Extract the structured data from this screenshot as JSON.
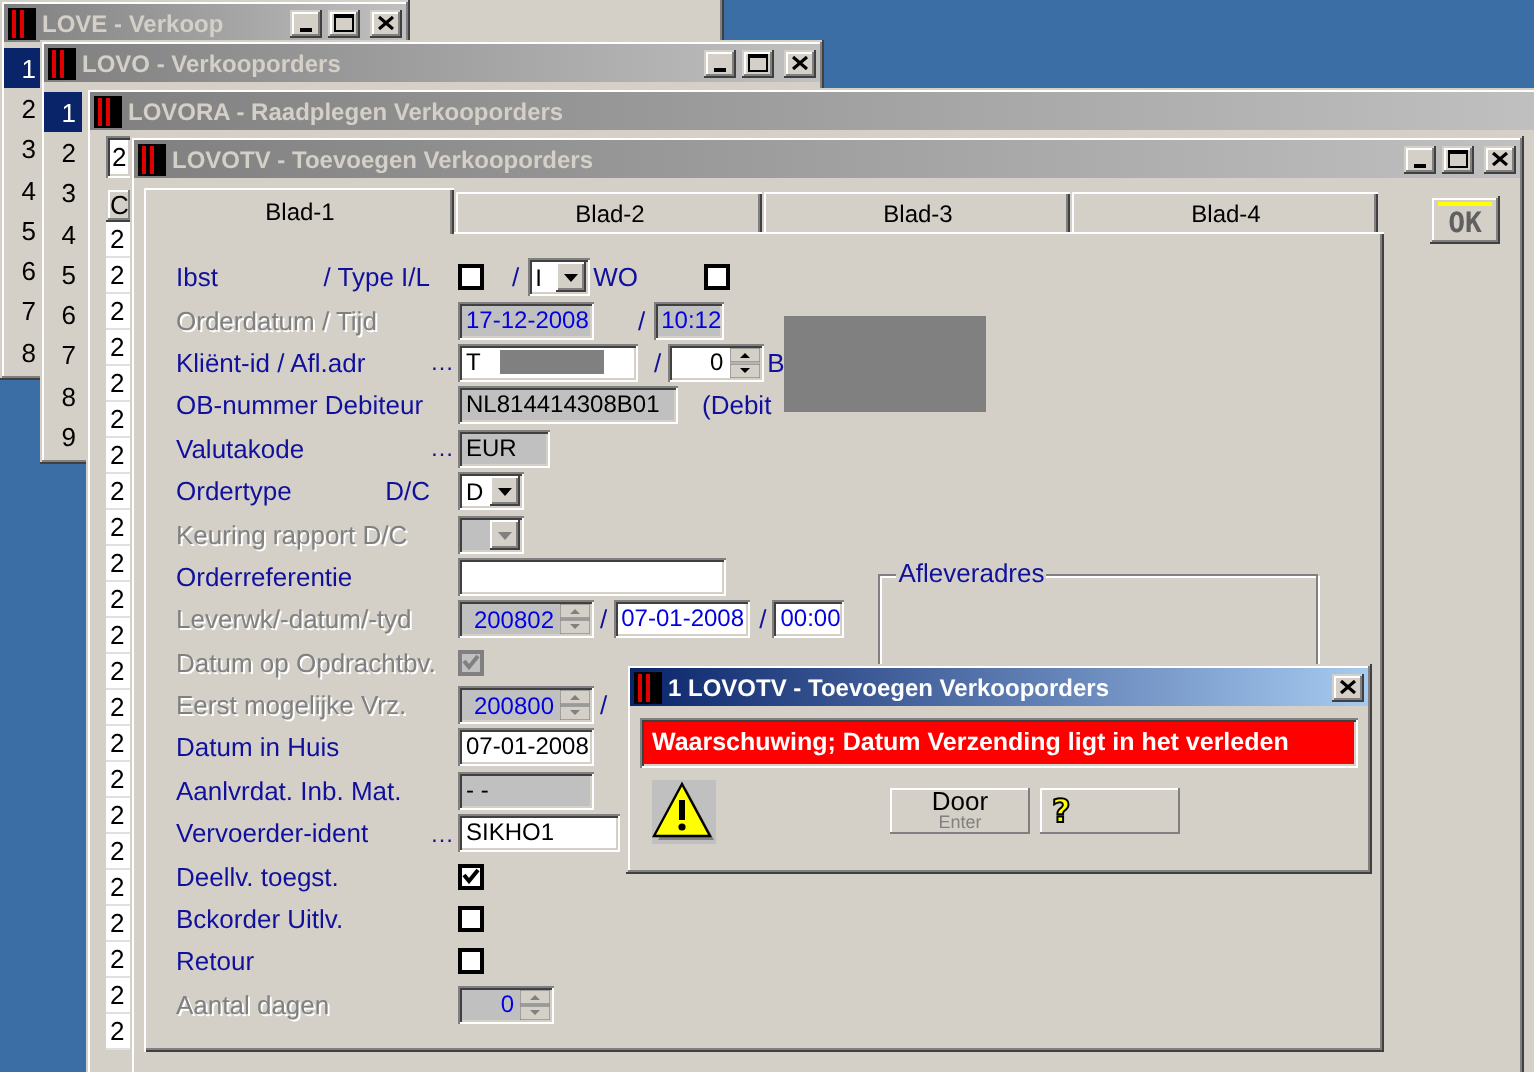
{
  "windows": [
    {
      "kind": "list",
      "title": "LOVE - Verkoop",
      "window_buttons": true,
      "items": [
        {
          "label": "1",
          "selected": true
        },
        {
          "label": "2",
          "selected": false
        },
        {
          "label": "3",
          "selected": false
        },
        {
          "label": "4",
          "selected": false
        },
        {
          "label": "5",
          "selected": false
        },
        {
          "label": "6",
          "selected": false
        },
        {
          "label": "7",
          "selected": false
        },
        {
          "label": "8",
          "selected": false
        }
      ]
    },
    {
      "kind": "list",
      "title": "LOVO - Verkooporders",
      "window_buttons": true,
      "items": [
        {
          "label": "1",
          "selected": true
        },
        {
          "label": "2",
          "selected": false
        },
        {
          "label": "3",
          "selected": false
        },
        {
          "label": "4",
          "selected": false
        },
        {
          "label": "5",
          "selected": false
        },
        {
          "label": "6",
          "selected": false
        },
        {
          "label": "7",
          "selected": false
        },
        {
          "label": "8",
          "selected": false
        },
        {
          "label": "9",
          "selected": false
        }
      ]
    },
    {
      "kind": "table",
      "title": "LOVORA - Raadplegen Verkooporders",
      "window_buttons": false,
      "field_value": "2",
      "column": "C",
      "rows": [
        "2",
        "2",
        "2",
        "2",
        "2",
        "2",
        "2",
        "2",
        "2",
        "2",
        "2",
        "2",
        "2",
        "2",
        "2",
        "2",
        "2",
        "2",
        "2",
        "2",
        "2",
        "2",
        "2"
      ]
    }
  ],
  "main_window": {
    "title": "LOVOTV - Toevoegen Verkooporders",
    "window_buttons": true,
    "tabs": [
      {
        "label": "Blad-1",
        "selected": true
      },
      {
        "label": "Blad-2",
        "selected": false
      },
      {
        "label": "Blad-3",
        "selected": false
      },
      {
        "label": "Blad-4",
        "selected": false
      }
    ],
    "ok_button": "OK",
    "form": [
      {
        "label": "Ibst",
        "label2": "/ Type I/L",
        "disabled": false,
        "controls": [
          {
            "kind": "checkbox",
            "checked": false
          },
          {
            "kind": "text",
            "text": "/"
          },
          {
            "kind": "combo",
            "value": "I"
          },
          {
            "kind": "text",
            "text": "WO"
          },
          {
            "kind": "checkbox",
            "checked": false
          }
        ]
      },
      {
        "label": "Orderdatum / Tijd",
        "disabled": true,
        "controls": [
          {
            "kind": "field",
            "value": "17-12-2008",
            "readonly": true
          },
          {
            "kind": "text",
            "text": "/"
          },
          {
            "kind": "field",
            "value": "10:12",
            "readonly": true
          }
        ]
      },
      {
        "label": "Kliënt-id / Afl.adr",
        "lookup": "…",
        "disabled": false,
        "controls": [
          {
            "kind": "field",
            "value": "T",
            "readonly": false,
            "redacted": true
          },
          {
            "kind": "text",
            "text": "/"
          },
          {
            "kind": "spin",
            "value": "0",
            "readonly": false
          },
          {
            "kind": "text",
            "text": "B"
          },
          {
            "kind": "redacted"
          }
        ]
      },
      {
        "label": "OB-nummer Debiteur",
        "disabled": false,
        "controls": [
          {
            "kind": "field",
            "value": "NL814414308B01",
            "readonly": true
          },
          {
            "kind": "text",
            "text": "(Debit"
          }
        ]
      },
      {
        "label": "Valutakode",
        "lookup": "…",
        "disabled": false,
        "controls": [
          {
            "kind": "field",
            "value": "EUR",
            "readonly": true
          }
        ]
      },
      {
        "label": "Ordertype",
        "label2": "D/C",
        "disabled": false,
        "controls": [
          {
            "kind": "combo",
            "value": "D"
          }
        ]
      },
      {
        "label": "Keuring rapport D/C",
        "disabled": true,
        "controls": [
          {
            "kind": "combo"
          }
        ]
      },
      {
        "label": "Orderreferentie",
        "disabled": false,
        "controls": [
          {
            "kind": "field",
            "readonly": false
          }
        ]
      },
      {
        "label": "Leverwk/-datum/-tyd",
        "disabled": true,
        "controls": [
          {
            "kind": "spin",
            "value": "200802",
            "readonly": true
          },
          {
            "kind": "text",
            "text": "/"
          },
          {
            "kind": "field",
            "value": "07-01-2008",
            "readonly": false
          },
          {
            "kind": "text",
            "text": "/"
          },
          {
            "kind": "field",
            "value": "00:00",
            "readonly": false
          },
          {
            "kind": "group",
            "label": "Afleveradres"
          }
        ]
      },
      {
        "label": "Datum op Opdrachtbv.",
        "disabled": true,
        "controls": [
          {
            "kind": "checkbox",
            "checked": true
          }
        ]
      },
      {
        "label": "Eerst mogelijke Vrz.",
        "disabled": true,
        "controls": [
          {
            "kind": "spin",
            "value": "200800",
            "readonly": true
          },
          {
            "kind": "text",
            "text": "/"
          }
        ]
      },
      {
        "label": "Datum in Huis",
        "disabled": false,
        "controls": [
          {
            "kind": "field",
            "value": "07-01-2008",
            "readonly": false
          }
        ]
      },
      {
        "label": "Aanlvrdat. Inb. Mat.",
        "disabled": false,
        "controls": [
          {
            "kind": "field",
            "value": "- -",
            "readonly": true
          }
        ]
      },
      {
        "label": "Vervoerder-ident",
        "lookup": "…",
        "disabled": false,
        "controls": [
          {
            "kind": "field",
            "value": "SIKHO1",
            "readonly": false
          }
        ]
      },
      {
        "label": "Deellv. toegst.",
        "disabled": false,
        "controls": [
          {
            "kind": "checkbox",
            "checked": true
          }
        ]
      },
      {
        "label": "Bckorder Uitlv.",
        "disabled": false,
        "controls": [
          {
            "kind": "checkbox",
            "checked": false
          }
        ]
      },
      {
        "label": "Retour",
        "disabled": false,
        "controls": [
          {
            "kind": "checkbox",
            "checked": false
          }
        ]
      },
      {
        "label": "Aantal dagen",
        "disabled": true,
        "controls": [
          {
            "kind": "spin",
            "value": "0",
            "readonly": true
          }
        ]
      }
    ]
  },
  "dialog": {
    "title": "1 LOVOTV - Toevoegen Verkooporders",
    "message": "Waarschuwing; Datum Verzending ligt in het verleden",
    "buttons": [
      {
        "label": "Door",
        "hint": "Enter"
      }
    ],
    "help_button": "?"
  }
}
